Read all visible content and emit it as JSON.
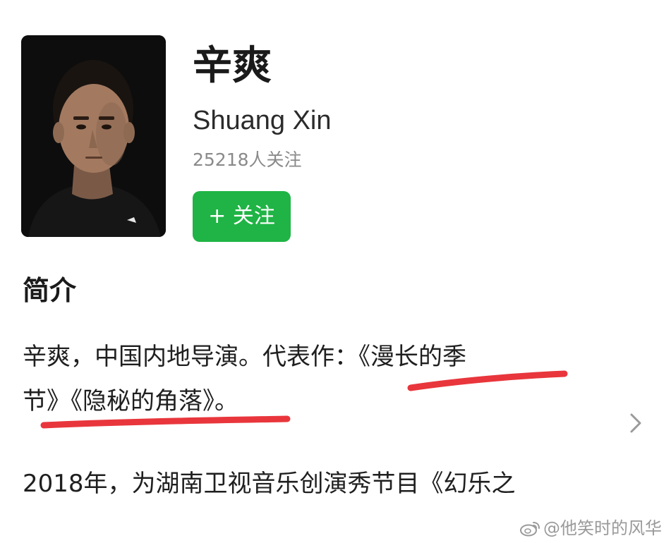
{
  "profile": {
    "name": "辛爽",
    "english_name": "Shuang Xin",
    "followers": "25218人关注",
    "follow_button": "+ 关注"
  },
  "intro": {
    "title": "简介",
    "line1": "辛爽，中国内地导演。代表作：《漫长的季",
    "line2": "节》《隐秘的角落》。",
    "line3": "2018年，为湖南卫视音乐创演秀节目《幻乐之"
  },
  "watermark": {
    "text": "@他笑时的风华",
    "icon": "weibo-icon"
  },
  "icons": {
    "expand": "chevron-right-icon"
  },
  "colors": {
    "follow_button": "#1fb445",
    "annotation_underline": "#e8363c",
    "secondary_text": "#8a8a8a"
  }
}
